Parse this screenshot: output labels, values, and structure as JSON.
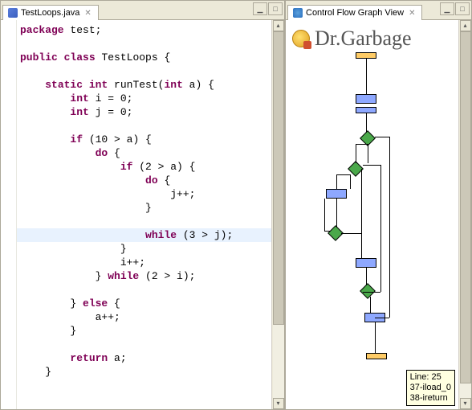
{
  "left": {
    "tab_label": "TestLoops.java",
    "win_min": "▁",
    "win_max": "□"
  },
  "right": {
    "tab_label": "Control Flow Graph View",
    "win_min": "▁",
    "win_max": "□",
    "brand": "Dr.Garbage"
  },
  "code": {
    "lines": [
      {
        "pre": "",
        "kw": "package",
        "post": " test;"
      },
      {
        "pre": "",
        "kw": "",
        "post": ""
      },
      {
        "pre": "",
        "kw": "public",
        "post": " ",
        "kw2": "class",
        "post2": " TestLoops {"
      },
      {
        "pre": "",
        "kw": "",
        "post": ""
      },
      {
        "pre": "    ",
        "kw": "static",
        "post": " ",
        "kw2": "int",
        "post2": " runTest(",
        "kw3": "int",
        "post3": " a) {"
      },
      {
        "pre": "        ",
        "kw": "int",
        "post": " i = 0;"
      },
      {
        "pre": "        ",
        "kw": "int",
        "post": " j = 0;"
      },
      {
        "pre": "",
        "kw": "",
        "post": ""
      },
      {
        "pre": "        ",
        "kw": "if",
        "post": " (10 > a) {"
      },
      {
        "pre": "            ",
        "kw": "do",
        "post": " {"
      },
      {
        "pre": "                ",
        "kw": "if",
        "post": " (2 > a) {"
      },
      {
        "pre": "                    ",
        "kw": "do",
        "post": " {"
      },
      {
        "pre": "                        ",
        "kw": "",
        "post": "j++;"
      },
      {
        "pre": "                    ",
        "kw": "",
        "post": "}"
      },
      {
        "pre": "",
        "kw": "",
        "post": ""
      },
      {
        "pre": "                    ",
        "kw": "while",
        "post": " (3 > j);"
      },
      {
        "pre": "                ",
        "kw": "",
        "post": "}"
      },
      {
        "pre": "                ",
        "kw": "",
        "post": "i++;"
      },
      {
        "pre": "            ",
        "kw": "",
        "post": "} ",
        "kw2": "while",
        "post2": " (2 > i);"
      },
      {
        "pre": "",
        "kw": "",
        "post": ""
      },
      {
        "pre": "        ",
        "kw": "",
        "post": "} ",
        "kw2": "else",
        "post2": " {"
      },
      {
        "pre": "            ",
        "kw": "",
        "post": "a++;"
      },
      {
        "pre": "        ",
        "kw": "",
        "post": "}"
      },
      {
        "pre": "",
        "kw": "",
        "post": ""
      },
      {
        "pre": "        ",
        "kw": "return",
        "post": " a;"
      },
      {
        "pre": "    ",
        "kw": "",
        "post": "}"
      }
    ],
    "highlight_index": 15
  },
  "tooltip": {
    "l1": "Line: 25",
    "l2": "37-iload_0",
    "l3": "38-ireturn"
  },
  "scroll": {
    "up": "▴",
    "down": "▾"
  }
}
